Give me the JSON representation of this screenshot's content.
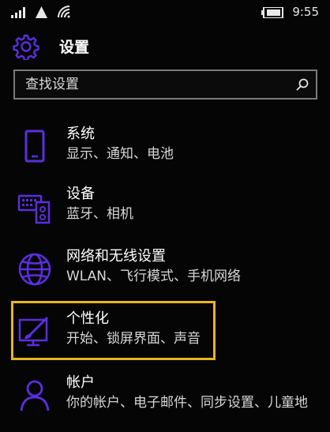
{
  "status_bar": {
    "time": "9:55",
    "icons": [
      "signal-icon",
      "triangle-icon",
      "wifi-icon",
      "battery-icon"
    ]
  },
  "header": {
    "title": "设置",
    "icon": "gear-icon"
  },
  "search": {
    "placeholder": "查找设置",
    "value": "",
    "icon": "search-icon"
  },
  "theme": {
    "accent": "#5b2ee0",
    "highlight": "#e8b61d",
    "background": "#050505",
    "text": "#ffffff",
    "subtext": "#d6d6d6"
  },
  "items": [
    {
      "icon": "phone-icon",
      "title": "系统",
      "subtitle": "显示、通知、电池"
    },
    {
      "icon": "devices-icon",
      "title": "设备",
      "subtitle": "蓝牙、相机"
    },
    {
      "icon": "globe-icon",
      "title": "网络和无线设置",
      "subtitle": "WLAN、飞行模式、手机网络"
    },
    {
      "icon": "personalization-icon",
      "title": "个性化",
      "subtitle": "开始、锁屏界面、声音",
      "highlighted": true
    },
    {
      "icon": "person-icon",
      "title": "帐户",
      "subtitle": "你的帐户、电子邮件、同步设置、儿童地"
    }
  ]
}
